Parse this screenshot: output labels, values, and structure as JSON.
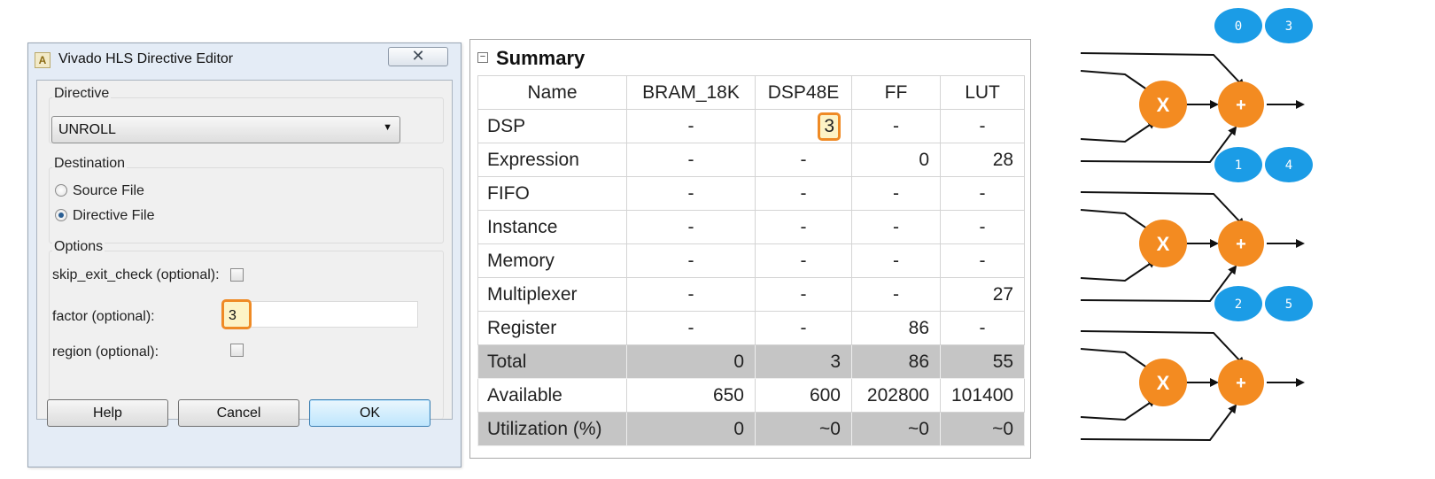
{
  "dialog": {
    "title": "Vivado HLS Directive Editor",
    "close_symbol": "✕",
    "directive_label": "Directive",
    "directive_value": "UNROLL",
    "destination_label": "Destination",
    "destination_options": [
      "Source File",
      "Directive File"
    ],
    "destination_selected": "Directive File",
    "options_label": "Options",
    "options": {
      "skip_exit_check": "skip_exit_check (optional):",
      "factor": "factor (optional):",
      "factor_value": "3",
      "region": "region (optional):"
    },
    "buttons": {
      "help": "Help",
      "cancel": "Cancel",
      "ok": "OK"
    }
  },
  "summary": {
    "title": "Summary",
    "columns": [
      "Name",
      "BRAM_18K",
      "DSP48E",
      "FF",
      "LUT"
    ],
    "rows": [
      [
        "DSP",
        "-",
        "3",
        "-",
        "-"
      ],
      [
        "Expression",
        "-",
        "-",
        "0",
        "28"
      ],
      [
        "FIFO",
        "-",
        "-",
        "-",
        "-"
      ],
      [
        "Instance",
        "-",
        "-",
        "-",
        "-"
      ],
      [
        "Memory",
        "-",
        "-",
        "-",
        "-"
      ],
      [
        "Multiplexer",
        "-",
        "-",
        "-",
        "27"
      ],
      [
        "Register",
        "-",
        "-",
        "86",
        "-"
      ],
      [
        "Total",
        "0",
        "3",
        "86",
        "55"
      ],
      [
        "Available",
        "650",
        "600",
        "202800",
        "101400"
      ],
      [
        "Utilization (%)",
        "0",
        "~0",
        "~0",
        "~0"
      ]
    ],
    "shaded_rows": [
      "Total",
      "Utilization (%)"
    ]
  },
  "diagram": {
    "colors": {
      "operator": "#f38b21",
      "index_badge": "#1b9ce6"
    },
    "multiply_symbol": "X",
    "add_symbol": "+",
    "units": [
      {
        "indices": [
          "0",
          "3"
        ]
      },
      {
        "indices": [
          "1",
          "4"
        ]
      },
      {
        "indices": [
          "2",
          "5"
        ]
      }
    ]
  }
}
